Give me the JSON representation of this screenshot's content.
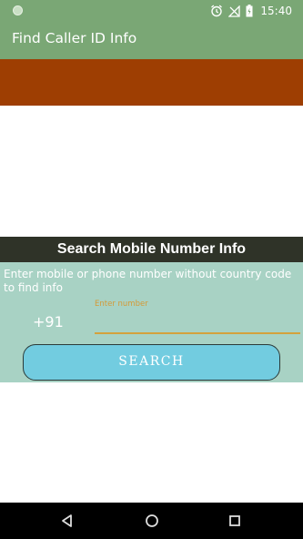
{
  "status_bar": {
    "time": "15:40",
    "icons": [
      "alarm-icon",
      "signal-off-icon",
      "battery-charging-icon"
    ]
  },
  "app_bar": {
    "title": "Find Caller ID Info"
  },
  "search": {
    "header": "Search Mobile Number Info",
    "instruction": "Enter mobile or phone number without country code to find info",
    "country_code": "+91",
    "number_label": "Enter number",
    "number_value": "",
    "button_label": "SEARCH"
  },
  "nav_bar": {
    "icons": [
      "back-icon",
      "home-icon",
      "recents-icon"
    ]
  },
  "colors": {
    "app_bar": "#7aa775",
    "banner": "#9e3e02",
    "search_header": "#2f3328",
    "search_panel": "#a8d2c4",
    "button": "#72cce0",
    "field_accent": "#d4a23c"
  }
}
